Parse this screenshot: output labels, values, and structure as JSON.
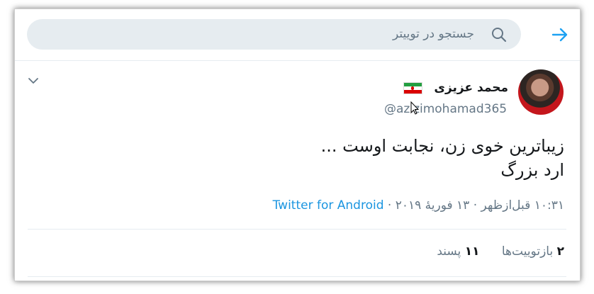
{
  "search": {
    "placeholder": "جستجو در توییتر"
  },
  "colors": {
    "accent": "#1da1f2",
    "source_link": "#1b95e0",
    "secondary_text": "#657786",
    "primary_text": "#14171a",
    "search_bg": "#e6ecf0"
  },
  "icons": {
    "back": "back-arrow-icon",
    "search": "search-icon",
    "menu": "chevron-down-icon",
    "flag": "iran-flag-icon"
  },
  "tweet": {
    "author_name": "محمد عزیزی",
    "handle": "@azizimohamad365",
    "text_line1": "زیباترین خوی زن، نجابت اوست ...",
    "text_line2": "ارد بزرگ",
    "timestamp": "۱۰:۳۱ قبل‌ازظهر · ۱۳ فوریهٔ ۲۰۱۹",
    "separator": " · ",
    "source": "Twitter for Android"
  },
  "stats": {
    "retweets_count": "۲",
    "retweets_label": "بازتوییت‌ها",
    "likes_count": "۱۱",
    "likes_label": "پسند"
  }
}
